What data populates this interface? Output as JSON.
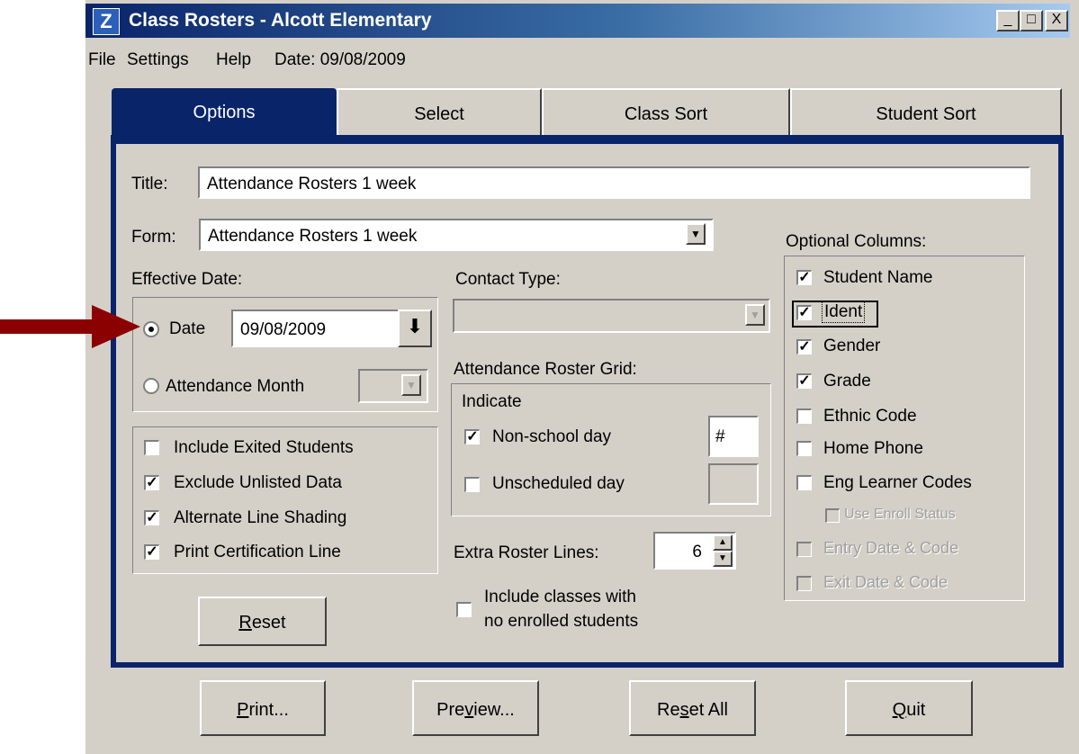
{
  "window": {
    "title": "Class Rosters - Alcott Elementary",
    "icon": "Z"
  },
  "titlebar_buttons": {
    "minimize": "_",
    "maximize": "□",
    "close": "X"
  },
  "menu": {
    "file": "File",
    "settings": "Settings",
    "help": "Help",
    "date": "Date: 09/08/2009"
  },
  "tabs": [
    {
      "label": "Options"
    },
    {
      "label": "Select"
    },
    {
      "label": "Class Sort"
    },
    {
      "label": "Student Sort"
    }
  ],
  "form": {
    "title_label": "Title:",
    "title_value": "Attendance Rosters 1 week",
    "form_label": "Form:",
    "form_value": "Attendance Rosters 1 week",
    "effective_date_label": "Effective Date:",
    "date_option": "Date",
    "date_value": "09/08/2009",
    "attendance_month_option": "Attendance Month",
    "contact_type_label": "Contact Type:",
    "grid_label": "Attendance Roster Grid:",
    "indicate_label": "Indicate",
    "non_school_day": "Non-school day",
    "non_school_symbol": "#",
    "unscheduled_day": "Unscheduled day",
    "extra_lines_label": "Extra Roster Lines:",
    "extra_lines_value": "6",
    "include_classes_line1": "Include classes with",
    "include_classes_line2": "no enrolled students"
  },
  "options_checks": [
    {
      "label": "Include Exited Students",
      "checked": false
    },
    {
      "label": "Exclude Unlisted Data",
      "checked": true
    },
    {
      "label": "Alternate Line Shading",
      "checked": true
    },
    {
      "label": "Print Certification Line",
      "checked": true
    }
  ],
  "optional_columns": {
    "label": "Optional Columns:",
    "items": [
      {
        "label": "Student Name",
        "checked": true
      },
      {
        "label": "Ident",
        "checked": true
      },
      {
        "label": "Gender",
        "checked": true
      },
      {
        "label": "Grade",
        "checked": true
      },
      {
        "label": "Ethnic Code",
        "checked": false
      },
      {
        "label": "Home Phone",
        "checked": false
      },
      {
        "label": "Eng Learner Codes",
        "checked": false
      },
      {
        "label": "Use Enroll Status",
        "checked": false,
        "disabled": true
      },
      {
        "label": "Entry Date & Code",
        "checked": false,
        "disabled": true
      },
      {
        "label": "Exit Date & Code",
        "checked": false,
        "disabled": true
      }
    ]
  },
  "buttons": {
    "reset_access": "R",
    "reset_rest": "eset",
    "print_access": "P",
    "print_rest": "rint...",
    "preview_a": "Pre",
    "preview_access": "v",
    "preview_b": "iew...",
    "resetall_a": "Re",
    "resetall_access": "s",
    "resetall_b": "et All",
    "quit_access": "Q",
    "quit_rest": "uit"
  },
  "colors": {
    "accent": "#0a246a",
    "arrow": "#8b0000",
    "face": "#d4d0c8"
  }
}
